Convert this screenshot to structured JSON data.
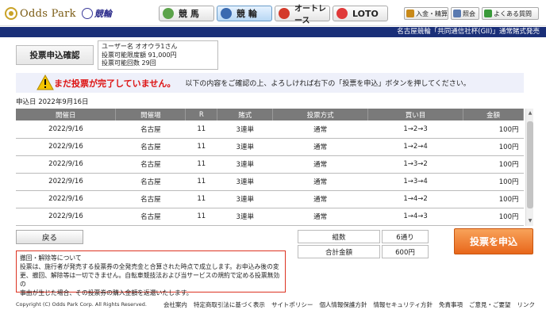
{
  "header": {
    "logo_text": "Odds Park",
    "logo_sub": "競輪",
    "tabs": [
      {
        "label": "競 馬",
        "icon": "horse-icon",
        "active": false
      },
      {
        "label": "競 輪",
        "icon": "bicycle-icon",
        "active": true
      },
      {
        "label": "オートレース",
        "icon": "autorace-icon",
        "active": false
      },
      {
        "label": "LOTO",
        "icon": "loto-icon",
        "active": false
      }
    ],
    "buttons": [
      {
        "label": "入金・精算",
        "icon": "yen-icon"
      },
      {
        "label": "照会",
        "icon": "list-icon"
      },
      {
        "label": "よくある質問",
        "icon": "question-icon"
      }
    ]
  },
  "band": {
    "text": "名古屋競輪「共同通信社杯(GII)」通常賭式発売"
  },
  "page": {
    "title": "投票申込確認",
    "user": {
      "name_line": "ユーザー名 オオウラ1さん",
      "limit_line": "投票可能限度額 91,000円",
      "count_line": "投票可能回数 29回"
    },
    "warning": {
      "main": "まだ投票が完了していません。",
      "sub": "以下の内容をご確認の上、よろしければ右下の「投票を申込」ボタンを押してください。"
    },
    "apply_date": "申込日 2022年9月16日"
  },
  "table": {
    "columns": [
      "開催日",
      "開催場",
      "R",
      "賭式",
      "投票方式",
      "買い目",
      "金額"
    ],
    "rows": [
      [
        "2022/9/16",
        "名古屋",
        "11",
        "3連単",
        "通常",
        "1→2→3",
        "100円"
      ],
      [
        "2022/9/16",
        "名古屋",
        "11",
        "3連単",
        "通常",
        "1→2→4",
        "100円"
      ],
      [
        "2022/9/16",
        "名古屋",
        "11",
        "3連単",
        "通常",
        "1→3→2",
        "100円"
      ],
      [
        "2022/9/16",
        "名古屋",
        "11",
        "3連単",
        "通常",
        "1→3→4",
        "100円"
      ],
      [
        "2022/9/16",
        "名古屋",
        "11",
        "3連単",
        "通常",
        "1→4→2",
        "100円"
      ],
      [
        "2022/9/16",
        "名古屋",
        "11",
        "3連単",
        "通常",
        "1→4→3",
        "100円"
      ]
    ]
  },
  "actions": {
    "back_label": "戻る",
    "submit_label": "投票を申込"
  },
  "summary": {
    "count_label": "組数",
    "count_value": "6通り",
    "total_label": "合計金額",
    "total_value": "600円"
  },
  "notice": {
    "lines": [
      "撤回・解除等について",
      "投票は、施行者が発売する投票券の全発売金と合算された時点で成立します。お申込み後の変",
      "更、撤回、解除等は一切できません。自転車競技法および当サービスの規約で定める投票無効の",
      "事由が生じた場合、その投票券の購入金額を返還いたします。"
    ]
  },
  "footer": {
    "copyright": "Copyright (C) Odds Park Corp. All Rights Reserved.",
    "links": [
      "会社案内",
      "特定商取引法に基づく表示",
      "サイトポリシー",
      "個人情報保護方針",
      "情報セキュリティ方針",
      "免責事項",
      "ご意見・ご要望",
      "リンク"
    ]
  },
  "colors": {
    "band": "#1a2f78",
    "warning_text": "#dd1111",
    "submit": "#e8661a",
    "table_header": "#7a7a7a"
  }
}
